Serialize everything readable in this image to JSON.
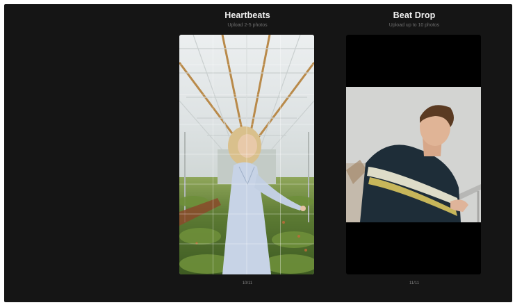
{
  "templates": [
    {
      "title": "Heartbeats",
      "subtitle": "Upload 2-5 photos",
      "counter": "10/11"
    },
    {
      "title": "Beat Drop",
      "subtitle": "Upload up to 10 photos",
      "counter": "11/11"
    }
  ],
  "colors": {
    "background": "#151515",
    "title": "#f2f2f2",
    "subtitle": "#6f6f6f",
    "counter": "#8a8a8a"
  }
}
